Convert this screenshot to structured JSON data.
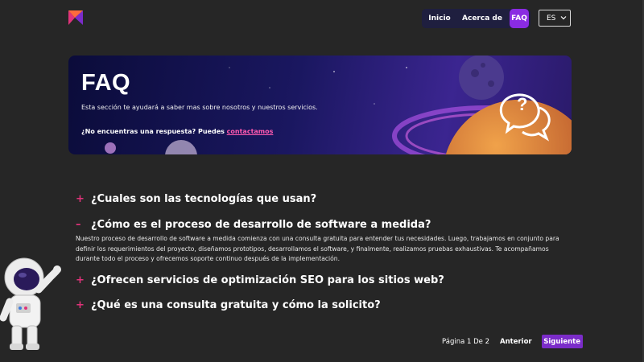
{
  "header": {
    "nav": [
      {
        "label": "Inicio"
      },
      {
        "label": "Acerca de"
      },
      {
        "label": "FAQ",
        "active": true
      }
    ],
    "language": {
      "selected": "ES"
    }
  },
  "hero": {
    "title": "FAQ",
    "subtitle": "Esta sección te ayudará a saber mas sobre nosotros y nuestros servicios.",
    "question": "¿No encuentras una respuesta? Puedes",
    "link": "contactamos"
  },
  "faq": [
    {
      "sign": "+",
      "question": "¿Cuales son las tecnologías que usan?",
      "expanded": false
    },
    {
      "sign": "–",
      "question": "¿Cómo es el proceso de desarrollo de software a medida?",
      "expanded": true,
      "answer": "Nuestro proceso de desarrollo de software a medida comienza con una consulta gratuita para entender tus necesidades. Luego, trabajamos en conjunto para definir los requerimientos del proyecto, diseñamos prototipos, desarrollamos el software, y finalmente, realizamos pruebas exhaustivas. Te acompañamos durante todo el proceso y ofrecemos soporte continuo después de la implementación."
    },
    {
      "sign": "+",
      "question": "¿Ofrecen servicios de optimización SEO para los sitios web?",
      "expanded": false
    },
    {
      "sign": "+",
      "question": "¿Qué es una consulta gratuita y cómo la solicito?",
      "expanded": false
    }
  ],
  "pagination": {
    "info": "Página 1 De 2",
    "prev": "Anterior",
    "next": "Siguiente"
  },
  "colors": {
    "accent": "#8a2be2",
    "pink": "#e0337a",
    "background": "#262626"
  },
  "icons": [
    "logo-icon",
    "chevron-down-icon",
    "chat-question-icon",
    "astronaut-illustration"
  ]
}
